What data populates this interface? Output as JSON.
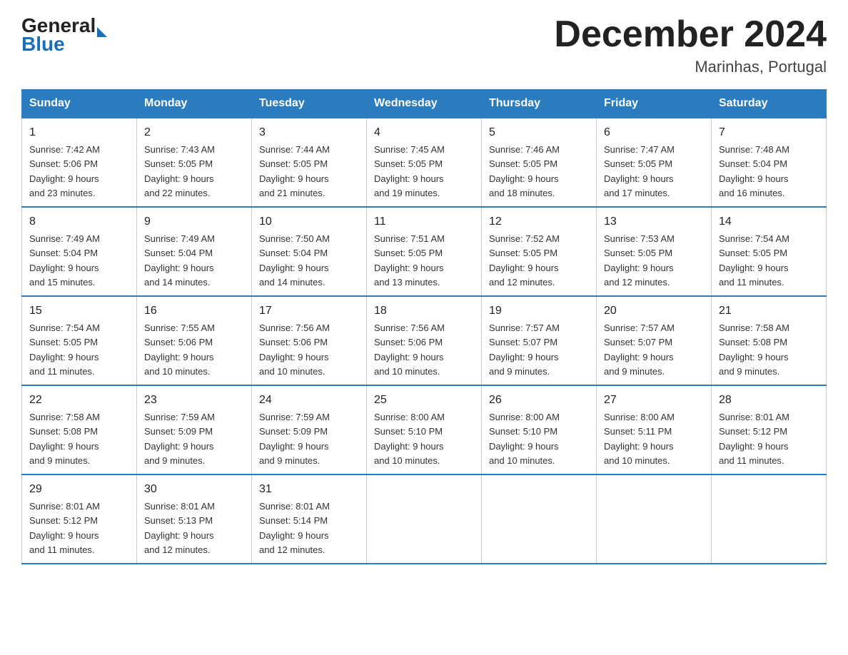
{
  "header": {
    "logo_general": "General",
    "logo_blue": "Blue",
    "title": "December 2024",
    "subtitle": "Marinhas, Portugal"
  },
  "days_of_week": [
    "Sunday",
    "Monday",
    "Tuesday",
    "Wednesday",
    "Thursday",
    "Friday",
    "Saturday"
  ],
  "weeks": [
    [
      {
        "day": "1",
        "sunrise": "7:42 AM",
        "sunset": "5:06 PM",
        "daylight": "9 hours and 23 minutes."
      },
      {
        "day": "2",
        "sunrise": "7:43 AM",
        "sunset": "5:05 PM",
        "daylight": "9 hours and 22 minutes."
      },
      {
        "day": "3",
        "sunrise": "7:44 AM",
        "sunset": "5:05 PM",
        "daylight": "9 hours and 21 minutes."
      },
      {
        "day": "4",
        "sunrise": "7:45 AM",
        "sunset": "5:05 PM",
        "daylight": "9 hours and 19 minutes."
      },
      {
        "day": "5",
        "sunrise": "7:46 AM",
        "sunset": "5:05 PM",
        "daylight": "9 hours and 18 minutes."
      },
      {
        "day": "6",
        "sunrise": "7:47 AM",
        "sunset": "5:05 PM",
        "daylight": "9 hours and 17 minutes."
      },
      {
        "day": "7",
        "sunrise": "7:48 AM",
        "sunset": "5:04 PM",
        "daylight": "9 hours and 16 minutes."
      }
    ],
    [
      {
        "day": "8",
        "sunrise": "7:49 AM",
        "sunset": "5:04 PM",
        "daylight": "9 hours and 15 minutes."
      },
      {
        "day": "9",
        "sunrise": "7:49 AM",
        "sunset": "5:04 PM",
        "daylight": "9 hours and 14 minutes."
      },
      {
        "day": "10",
        "sunrise": "7:50 AM",
        "sunset": "5:04 PM",
        "daylight": "9 hours and 14 minutes."
      },
      {
        "day": "11",
        "sunrise": "7:51 AM",
        "sunset": "5:05 PM",
        "daylight": "9 hours and 13 minutes."
      },
      {
        "day": "12",
        "sunrise": "7:52 AM",
        "sunset": "5:05 PM",
        "daylight": "9 hours and 12 minutes."
      },
      {
        "day": "13",
        "sunrise": "7:53 AM",
        "sunset": "5:05 PM",
        "daylight": "9 hours and 12 minutes."
      },
      {
        "day": "14",
        "sunrise": "7:54 AM",
        "sunset": "5:05 PM",
        "daylight": "9 hours and 11 minutes."
      }
    ],
    [
      {
        "day": "15",
        "sunrise": "7:54 AM",
        "sunset": "5:05 PM",
        "daylight": "9 hours and 11 minutes."
      },
      {
        "day": "16",
        "sunrise": "7:55 AM",
        "sunset": "5:06 PM",
        "daylight": "9 hours and 10 minutes."
      },
      {
        "day": "17",
        "sunrise": "7:56 AM",
        "sunset": "5:06 PM",
        "daylight": "9 hours and 10 minutes."
      },
      {
        "day": "18",
        "sunrise": "7:56 AM",
        "sunset": "5:06 PM",
        "daylight": "9 hours and 10 minutes."
      },
      {
        "day": "19",
        "sunrise": "7:57 AM",
        "sunset": "5:07 PM",
        "daylight": "9 hours and 9 minutes."
      },
      {
        "day": "20",
        "sunrise": "7:57 AM",
        "sunset": "5:07 PM",
        "daylight": "9 hours and 9 minutes."
      },
      {
        "day": "21",
        "sunrise": "7:58 AM",
        "sunset": "5:08 PM",
        "daylight": "9 hours and 9 minutes."
      }
    ],
    [
      {
        "day": "22",
        "sunrise": "7:58 AM",
        "sunset": "5:08 PM",
        "daylight": "9 hours and 9 minutes."
      },
      {
        "day": "23",
        "sunrise": "7:59 AM",
        "sunset": "5:09 PM",
        "daylight": "9 hours and 9 minutes."
      },
      {
        "day": "24",
        "sunrise": "7:59 AM",
        "sunset": "5:09 PM",
        "daylight": "9 hours and 9 minutes."
      },
      {
        "day": "25",
        "sunrise": "8:00 AM",
        "sunset": "5:10 PM",
        "daylight": "9 hours and 10 minutes."
      },
      {
        "day": "26",
        "sunrise": "8:00 AM",
        "sunset": "5:10 PM",
        "daylight": "9 hours and 10 minutes."
      },
      {
        "day": "27",
        "sunrise": "8:00 AM",
        "sunset": "5:11 PM",
        "daylight": "9 hours and 10 minutes."
      },
      {
        "day": "28",
        "sunrise": "8:01 AM",
        "sunset": "5:12 PM",
        "daylight": "9 hours and 11 minutes."
      }
    ],
    [
      {
        "day": "29",
        "sunrise": "8:01 AM",
        "sunset": "5:12 PM",
        "daylight": "9 hours and 11 minutes."
      },
      {
        "day": "30",
        "sunrise": "8:01 AM",
        "sunset": "5:13 PM",
        "daylight": "9 hours and 12 minutes."
      },
      {
        "day": "31",
        "sunrise": "8:01 AM",
        "sunset": "5:14 PM",
        "daylight": "9 hours and 12 minutes."
      },
      null,
      null,
      null,
      null
    ]
  ],
  "labels": {
    "sunrise_prefix": "Sunrise: ",
    "sunset_prefix": "Sunset: ",
    "daylight_prefix": "Daylight: "
  }
}
